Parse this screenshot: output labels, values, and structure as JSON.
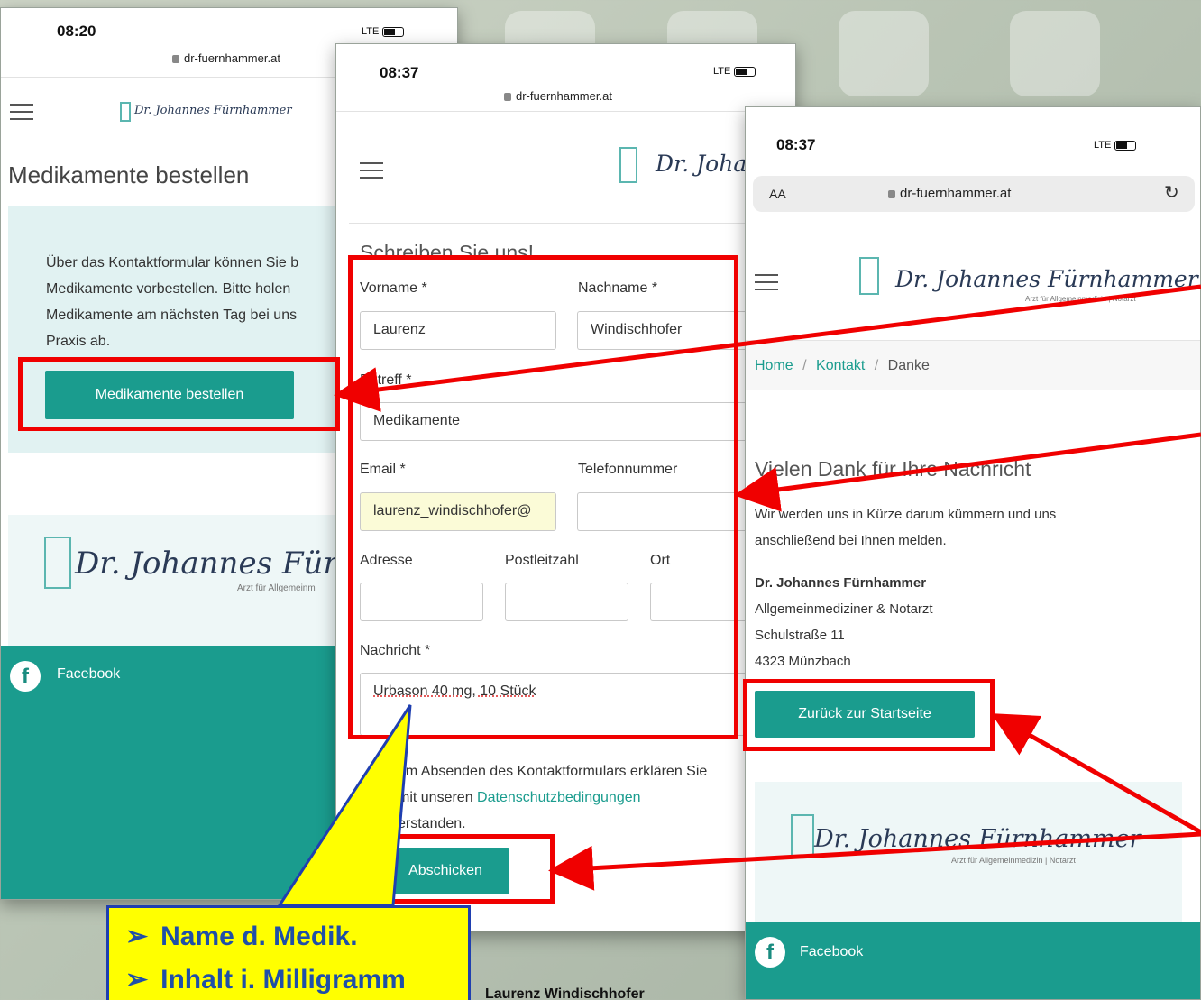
{
  "phone1": {
    "time": "08:20",
    "signal": "LTE",
    "url": "dr-fuernhammer.at",
    "logo_name": "Dr. Johannes Fürnhammer",
    "logo_sub": "Arzt für Allgemeinmedizin | Notarzt",
    "page_title": "Medikamente bestellen",
    "info_lines": [
      "Über das Kontaktformular können Sie b",
      "Medikamente vorbestellen. Bitte holen",
      "Medikamente am nächsten Tag bei uns",
      "Praxis ab."
    ],
    "order_button": "Medikamente bestellen",
    "footer_logo_name": "Dr. Johannes Fürnha",
    "footer_logo_sub": "Arzt für Allgemeinm",
    "facebook": "Facebook"
  },
  "phone2": {
    "time": "08:37",
    "signal": "LTE",
    "url": "dr-fuernhammer.at",
    "logo_name": "Dr. Johar",
    "form_heading": "Schreiben Sie uns!",
    "labels": {
      "vorname": "Vorname *",
      "nachname": "Nachname *",
      "betreff": "Betreff *",
      "email": "Email *",
      "telefon": "Telefonnummer",
      "adresse": "Adresse",
      "plz": "Postleitzahl",
      "ort": "Ort",
      "nachricht": "Nachricht *"
    },
    "values": {
      "vorname": "Laurenz",
      "nachname": "Windischhofer",
      "betreff": "Medikamente",
      "email": "laurenz_windischhofer@",
      "telefon": "",
      "adresse": "",
      "plz": "",
      "ort": "",
      "nachricht": "Urbason 40 mg, 10 Stück"
    },
    "consent_line1": "em Absenden des Kontaktformulars erklären Sie",
    "consent_line2_pre": "mit unseren ",
    "consent_link": "Datenschutzbedingungen",
    "consent_line3": "erstanden.",
    "submit_button": "Abschicken"
  },
  "phone3": {
    "time": "08:37",
    "signal": "LTE",
    "aa": "AA",
    "url": "dr-fuernhammer.at",
    "logo_name": "Dr. Johannes Fürnhammer",
    "logo_sub": "Arzt für Allgemeinmedizin | Notarzt",
    "breadcrumb": {
      "home": "Home",
      "kontakt": "Kontakt",
      "current": "Danke",
      "sep": "/"
    },
    "thanks_title": "Vielen Dank für Ihre Nachricht",
    "thanks_line1": "Wir werden uns in Kürze darum kümmern und uns",
    "thanks_line2": "anschließend bei Ihnen melden.",
    "address": {
      "name": "Dr. Johannes Fürnhammer",
      "role": "Allgemeinmediziner & Notarzt",
      "street": "Schulstraße 11",
      "city": "4323 Münzbach"
    },
    "back_button": "Zurück zur Startseite",
    "footer_logo_name": "Dr. Johannes Fürnhammer",
    "footer_logo_sub": "Arzt für Allgemeinmedizin | Notarzt",
    "facebook": "Facebook"
  },
  "callout": {
    "items": [
      "Name d. Medik.",
      "Inhalt i. Milligramm"
    ]
  },
  "bottom_caption": "Laurenz Windischhofer",
  "colors": {
    "teal": "#1a9c8e",
    "info_bg": "#e1f2f2",
    "highlight_red": "#f00000",
    "callout_bg": "#ffff00",
    "callout_text": "#1f4fa8"
  }
}
